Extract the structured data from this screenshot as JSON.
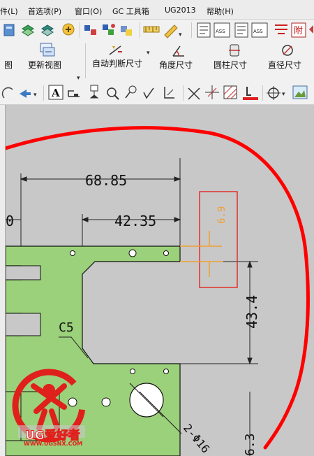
{
  "menu": {
    "items": [
      "件(L)",
      "首选项(P)",
      "窗口(O)",
      "GC 工具箱",
      "UG2013",
      "帮助(H)"
    ]
  },
  "ribbon": {
    "items": [
      {
        "label": "图",
        "icon": "view-icon"
      },
      {
        "label": "更新视图",
        "icon": "update-views-icon"
      },
      {
        "label": "自动判断尺寸",
        "icon": "rapid-dimension-icon"
      },
      {
        "label": "角度尺寸",
        "icon": "angular-dimension-icon"
      },
      {
        "label": "圆柱尺寸",
        "icon": "cylindrical-dimension-icon"
      },
      {
        "label": "直径尺寸",
        "icon": "diameter-dimension-icon"
      }
    ]
  },
  "toolbar_row1": {
    "icons": [
      "edit-icon",
      "view-green-icon",
      "view-3d-icon",
      "wizard-icon",
      "section-icon",
      "detail-icon",
      "component-icon",
      "dim-style-icon",
      "measure-icon",
      "gdt-icon",
      "ass-icon",
      "gdt-icon-2",
      "ass-icon-2",
      "weld-icon",
      "append-icon",
      "undo-icon"
    ],
    "text_badges": [
      "ASS",
      "ASS",
      "附"
    ]
  },
  "toolbar_row3": {
    "icons": [
      "arc-icon",
      "arrow-icon",
      "note-icon",
      "label-icon",
      "datum-icon",
      "zoom-icon",
      "probe-icon",
      "check-icon",
      "baseline-icon",
      "cross-icon",
      "centerline-icon",
      "hatch-icon",
      "underline-icon",
      "target-icon",
      "image-icon"
    ],
    "note_glyph": "A"
  },
  "drawing": {
    "dimensions": {
      "top_width": "68.85",
      "inner_width": "42.35",
      "small_vertical": "6.9",
      "right_vertical": "43.4",
      "left_partial": "0",
      "chamfer": "C5",
      "diameter": "2-Φ16",
      "bottom_right": "6.3"
    },
    "colors": {
      "part_fill": "#9bd17a",
      "highlight": "#e0302a",
      "markup": "#ff0000",
      "dimension_line": "#222222",
      "selected_dim": "#f0a030"
    }
  },
  "watermark": {
    "text": "UG爱好者",
    "url": "WWW.UGSNX.COM",
    "color": "#e0201a"
  }
}
